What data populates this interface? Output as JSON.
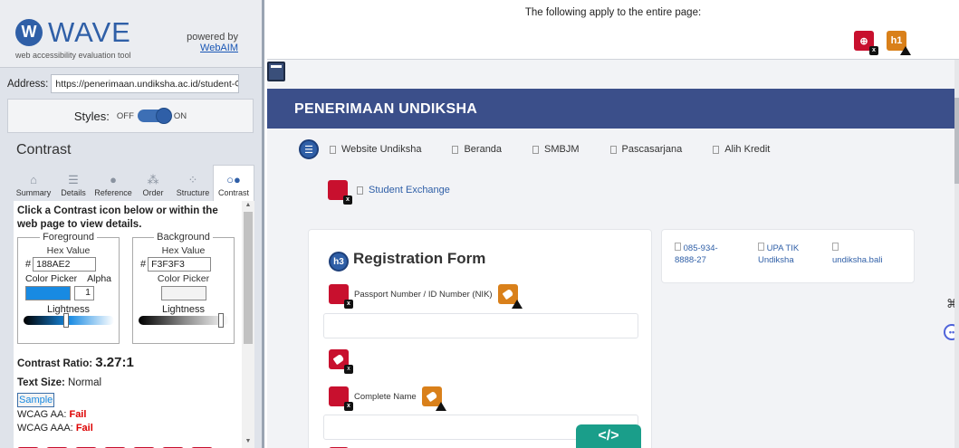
{
  "wave": {
    "logo_text": "WAVE",
    "tagline": "web accessibility evaluation tool",
    "powered_by": "powered by",
    "webaim_link": "WebAIM",
    "address_label": "Address:",
    "address_value": "https://penerimaan.undiksha.ac.id/student-",
    "styles_label": "Styles:",
    "styles_off": "OFF",
    "styles_on": "ON",
    "section_title": "Contrast",
    "tabs": [
      {
        "label": "Summary",
        "icon": "home-icon"
      },
      {
        "label": "Details",
        "icon": "list-icon"
      },
      {
        "label": "Reference",
        "icon": "info-icon"
      },
      {
        "label": "Order",
        "icon": "order-icon"
      },
      {
        "label": "Structure",
        "icon": "structure-icon"
      },
      {
        "label": "Contrast",
        "icon": "contrast-icon"
      }
    ],
    "active_tab": "Contrast",
    "contrast": {
      "instructions": "Click a Contrast icon below or within the web page to view details.",
      "foreground_legend": "Foreground",
      "background_legend": "Background",
      "hex_label": "Hex Value",
      "fg_hex": "188AE2",
      "bg_hex": "F3F3F3",
      "color_picker_label": "Color Picker",
      "alpha_label": "Alpha",
      "alpha_value": "1",
      "lightness_label": "Lightness",
      "fg_color": "#188AE2",
      "bg_color": "#F3F3F3",
      "ratio_label": "Contrast Ratio:",
      "ratio_value": "3.27:1",
      "text_size_label": "Text Size:",
      "text_size_value": "Normal",
      "sample_text": "Sample",
      "wcag_aa_label": "WCAG AA:",
      "wcag_aa_value": "Fail",
      "wcag_aaa_label": "WCAG AAA:",
      "wcag_aaa_value": "Fail"
    }
  },
  "summary": {
    "text": "The following apply to the entire page:",
    "h1_label": "h1"
  },
  "page": {
    "banner_title": "PENERIMAAN UNDIKSHA",
    "nav_items": [
      "Website Undiksha",
      "Beranda",
      "SMBJM",
      "Pascasarjana",
      "Alih Kredit"
    ],
    "exchange_link": "Student Exchange",
    "form_heading_tag": "h3",
    "form_title": "Registration Form",
    "field_passport": "Passport Number / ID Number (NIK)",
    "field_name": "Complete Name",
    "info": {
      "phone_line1": "085-934-",
      "phone_line2": "8888-27",
      "upa_line1": "UPA TIK",
      "upa_line2": "Undiksha",
      "social": "undiksha.bali"
    },
    "code_fab": "</>"
  },
  "colors": {
    "wave_blue": "#2f5fa7",
    "error_red": "#c8102e",
    "alert_orange": "#d9801a",
    "banner": "#3b4f8a",
    "fab_teal": "#1a9e8a"
  }
}
